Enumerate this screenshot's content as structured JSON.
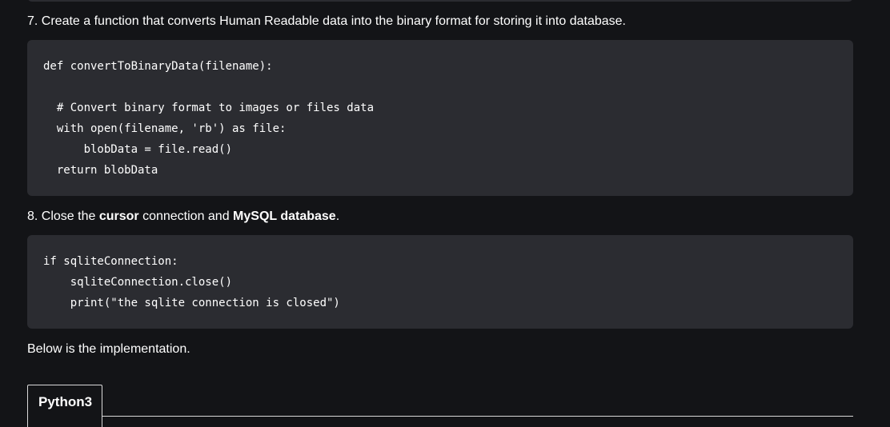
{
  "step7": {
    "text": "7. Create a function that converts Human Readable data into the binary format for storing it into database."
  },
  "code7": {
    "lines": [
      "def convertToBinaryData(filename):",
      "  # Convert binary format to images or files data",
      "  with open(filename, 'rb') as file:",
      "      blobData = file.read()",
      "  return blobData"
    ]
  },
  "step8": {
    "prefix": "8. Close the ",
    "cursor": "cursor",
    "middle": " connection and ",
    "db": "MySQL database",
    "suffix": "."
  },
  "code8": {
    "lines": [
      "if sqliteConnection:",
      "    sqliteConnection.close()",
      "    print(\"the sqlite connection is closed\")"
    ]
  },
  "below": {
    "text": "Below is the implementation."
  },
  "tabs": [
    {
      "label": "Python3"
    }
  ]
}
